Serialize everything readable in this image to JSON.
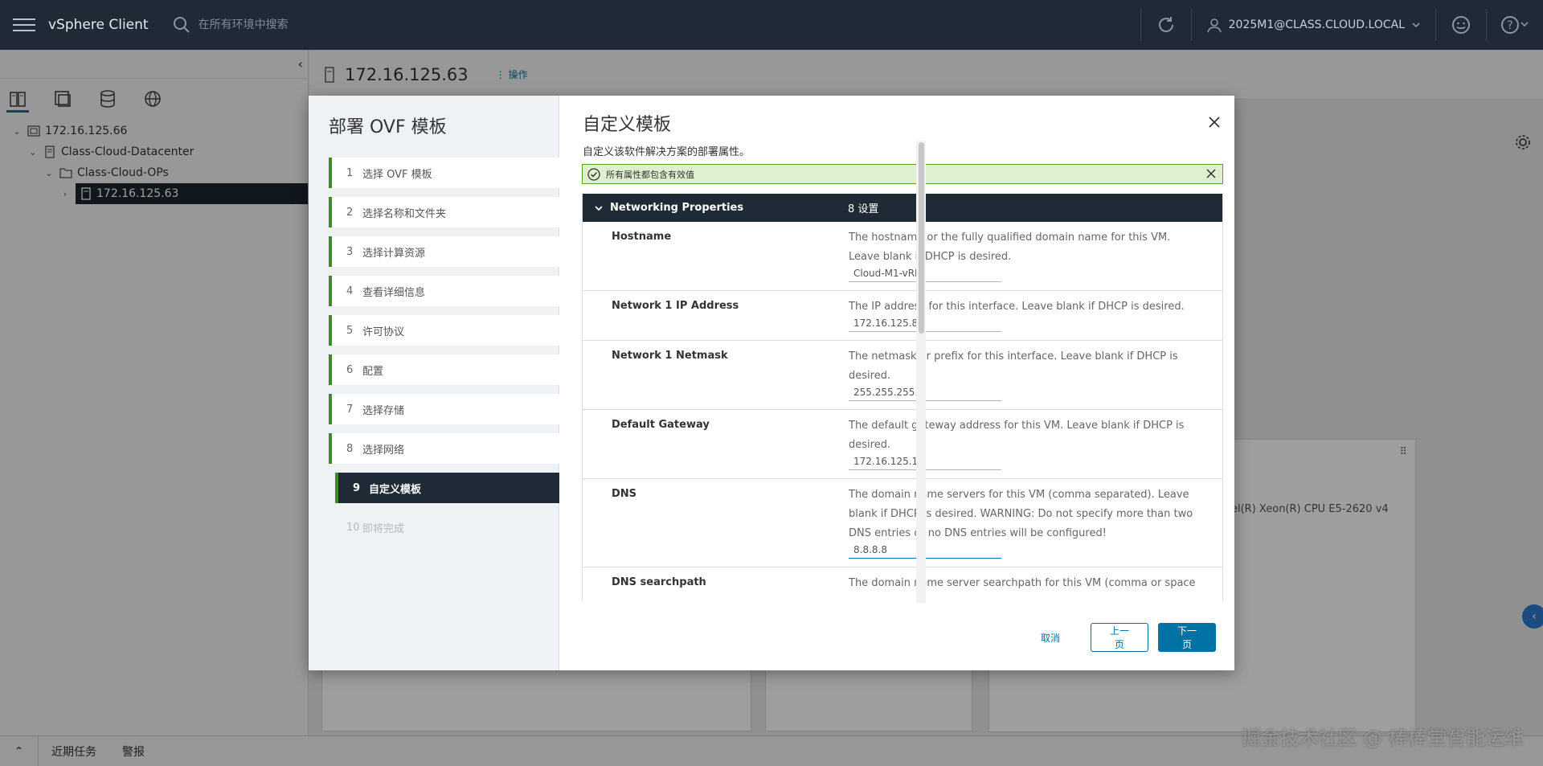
{
  "header": {
    "brand": "vSphere Client",
    "search_placeholder": "在所有环境中搜索",
    "user": "2025M1@CLASS.CLOUD.LOCAL"
  },
  "sidebar": {
    "tree": [
      {
        "label": "172.16.125.66",
        "icon": "vcenter-icon",
        "level": 0,
        "expanded": true
      },
      {
        "label": "Class-Cloud-Datacenter",
        "icon": "datacenter-icon",
        "level": 1,
        "expanded": true
      },
      {
        "label": "Class-Cloud-OPs",
        "icon": "folder-icon",
        "level": 2,
        "expanded": true
      },
      {
        "label": "172.16.125.63",
        "icon": "host-icon",
        "level": 3,
        "expanded": false,
        "selected": true
      }
    ]
  },
  "main": {
    "host_title": "172.16.125.63",
    "actions_label": "操作",
    "bg_cpu_text": "el(R) Xeon(R) CPU E5-2620 v4"
  },
  "bottombar": {
    "recent_tasks": "近期任务",
    "alarms": "警报"
  },
  "watermark": "掘金技术社区 @ 棒棒堂智能运维",
  "wizard": {
    "title": "部署 OVF 模板",
    "steps": [
      {
        "num": "1",
        "label": "选择 OVF 模板",
        "state": "done"
      },
      {
        "num": "2",
        "label": "选择名称和文件夹",
        "state": "done"
      },
      {
        "num": "3",
        "label": "选择计算资源",
        "state": "done"
      },
      {
        "num": "4",
        "label": "查看详细信息",
        "state": "done"
      },
      {
        "num": "5",
        "label": "许可协议",
        "state": "done"
      },
      {
        "num": "6",
        "label": "配置",
        "state": "done"
      },
      {
        "num": "7",
        "label": "选择存储",
        "state": "done"
      },
      {
        "num": "8",
        "label": "选择网络",
        "state": "done"
      },
      {
        "num": "9",
        "label": "自定义模板",
        "state": "active"
      },
      {
        "num": "10",
        "label": "即将完成",
        "state": "disabled"
      }
    ],
    "page_title": "自定义模板",
    "subtitle": "自定义该软件解决方案的部署属性。",
    "success_message": "所有属性都包含有效值",
    "group": {
      "name": "Networking Properties",
      "count": "8 设置"
    },
    "properties": [
      {
        "label": "Hostname",
        "desc": "The hostname or the fully qualified domain name for this VM. Leave blank if DHCP is desired.",
        "value": "Cloud-M1-vRLI"
      },
      {
        "label": "Network 1 IP Address",
        "desc": "The IP address for this interface. Leave blank if DHCP is desired.",
        "value": "172.16.125.87"
      },
      {
        "label": "Network 1 Netmask",
        "desc": "The netmask or prefix for this interface. Leave blank if DHCP is desired.",
        "value": "255.255.255.0"
      },
      {
        "label": "Default Gateway",
        "desc": "The default gateway address for this VM. Leave blank if DHCP is desired.",
        "value": "172.16.125.1"
      },
      {
        "label": "DNS",
        "desc": "The domain name servers for this VM (comma separated). Leave blank if DHCP is desired. WARNING: Do not specify more than two DNS entries or no DNS entries will be configured!",
        "value": "8.8.8.8"
      },
      {
        "label": "DNS searchpath",
        "desc": "The domain name server searchpath for this VM (comma or space",
        "value": ""
      }
    ],
    "buttons": {
      "cancel": "取消",
      "back": "上一页",
      "next": "下一页"
    }
  }
}
